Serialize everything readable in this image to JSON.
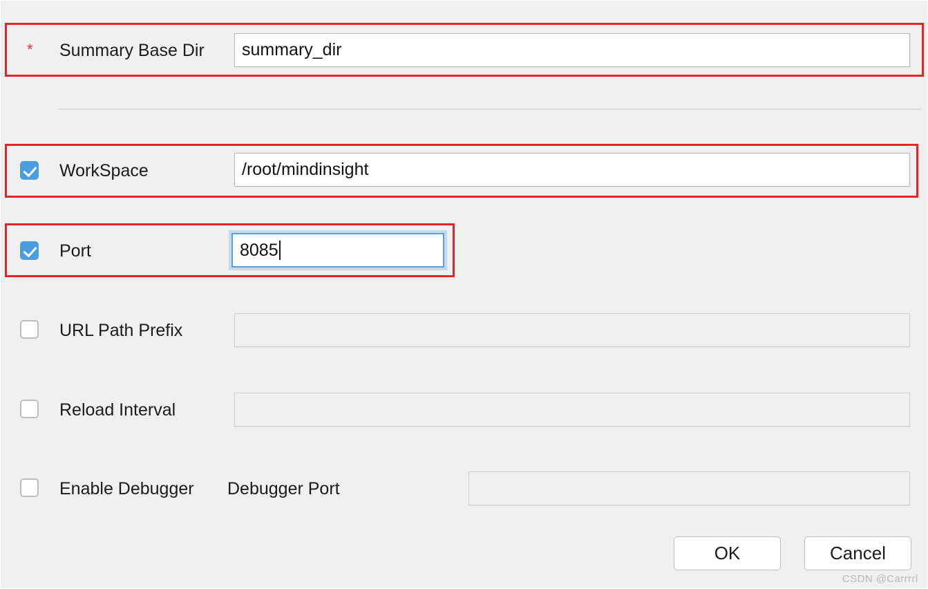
{
  "dialog": {
    "background_color": "#f0f0f0",
    "annotation_color": "#ea2227",
    "accent_color": "#4a9ee0"
  },
  "fields": [
    {
      "key": "summary_base_dir",
      "label": "Summary Base Dir",
      "required_marker": "*",
      "control": "required-text",
      "value": "summary_dir",
      "placeholder": "",
      "enabled": true,
      "focused": false,
      "highlighted": true
    },
    {
      "key": "workspace",
      "label": "WorkSpace",
      "control": "checkbox-text",
      "checked": true,
      "value": "/root/mindinsight",
      "placeholder": "",
      "enabled": true,
      "focused": false,
      "highlighted": true
    },
    {
      "key": "port",
      "label": "Port",
      "control": "checkbox-text",
      "checked": true,
      "value": "8085",
      "placeholder": "",
      "enabled": true,
      "focused": true,
      "highlighted": true
    },
    {
      "key": "url_path_prefix",
      "label": "URL Path Prefix",
      "control": "checkbox-text",
      "checked": false,
      "value": "",
      "placeholder": "",
      "enabled": false,
      "focused": false,
      "highlighted": false
    },
    {
      "key": "reload_interval",
      "label": "Reload Interval",
      "control": "checkbox-text",
      "checked": false,
      "value": "",
      "placeholder": "",
      "enabled": false,
      "focused": false,
      "highlighted": false
    },
    {
      "key": "enable_debugger",
      "label": "Enable Debugger",
      "secondary_label": "Debugger Port",
      "control": "checkbox-text",
      "checked": false,
      "value": "",
      "placeholder": "",
      "enabled": false,
      "focused": false,
      "highlighted": false
    }
  ],
  "buttons": {
    "ok": "OK",
    "cancel": "Cancel"
  },
  "watermark": "CSDN @Carrrrl"
}
